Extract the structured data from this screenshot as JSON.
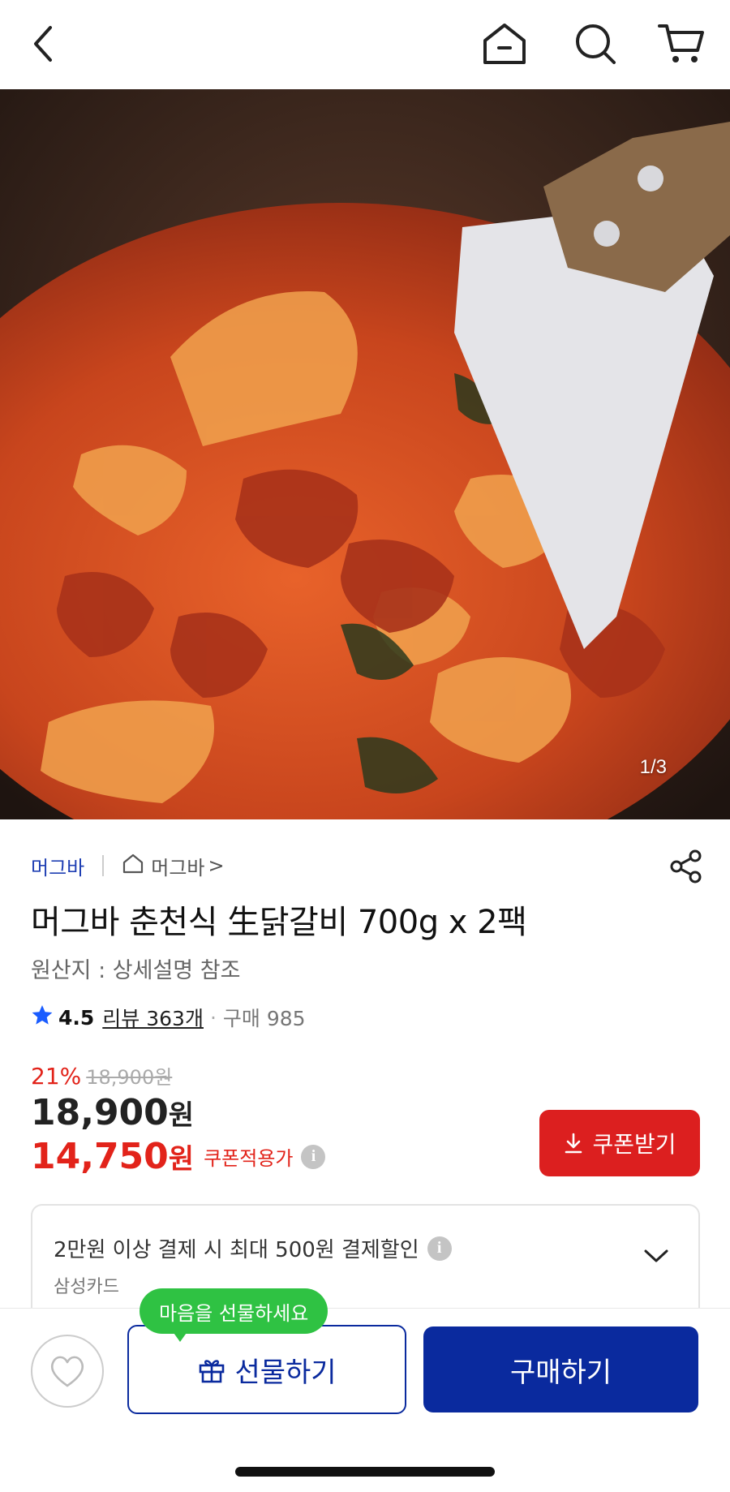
{
  "header": {
    "icons": [
      "back-icon",
      "home-icon",
      "search-icon",
      "cart-icon"
    ]
  },
  "hero": {
    "counter": "1/3"
  },
  "product": {
    "seller": "머그바",
    "store_label": "머그바",
    "store_chevron": ">",
    "title": "머그바 춘천식 生닭갈비 700g x 2팩",
    "origin": "원산지 : 상세설명 참조",
    "rating": "4.5",
    "review": "리뷰 363개",
    "dot": "·",
    "purchases": "구매 985"
  },
  "pricing": {
    "discount_rate": "21%",
    "original_price": "18,900원",
    "price_number": "18,900",
    "price_unit": "원",
    "coupon_price_number": "14,750",
    "coupon_price_unit": "원",
    "coupon_label": "쿠폰적용가",
    "coupon_button": "쿠폰받기",
    "info_glyph": "i",
    "accent_red": "#dc1f1f"
  },
  "card_benefit": {
    "title": "2만원 이상 결제 시 최대 500원 결제할인",
    "card_name": "삼성카드"
  },
  "bottom": {
    "bubble": "마음을 선물하세요",
    "gift_button": "선물하기",
    "buy_button": "구매하기",
    "primary_color": "#0a2a9e",
    "bubble_color": "#2fc243"
  }
}
